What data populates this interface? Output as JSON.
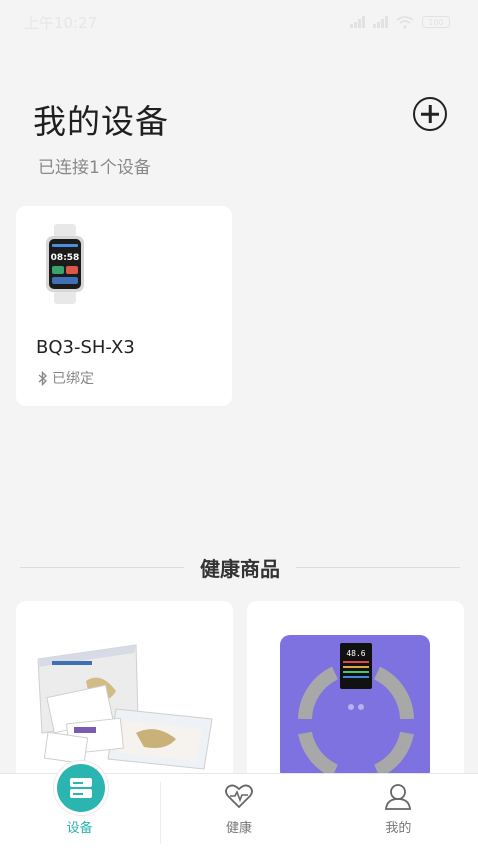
{
  "status_bar": {
    "time": "上午10:27",
    "battery": "100"
  },
  "header": {
    "title": "我的设备",
    "subtitle": "已连接1个设备"
  },
  "device": {
    "name": "BQ3-SH-X3",
    "status": "已绑定",
    "watch_time": "08:58"
  },
  "products_section": {
    "title": "健康商品"
  },
  "scale_display": "48.6",
  "tabs": [
    {
      "label": "设备",
      "icon": "device-icon",
      "active": true
    },
    {
      "label": "健康",
      "icon": "heart-pulse-icon",
      "active": false
    },
    {
      "label": "我的",
      "icon": "user-icon",
      "active": false
    }
  ],
  "colors": {
    "accent": "#2bb5b0",
    "background": "#f4f4f4",
    "scale_purple": "#7e71e0"
  }
}
